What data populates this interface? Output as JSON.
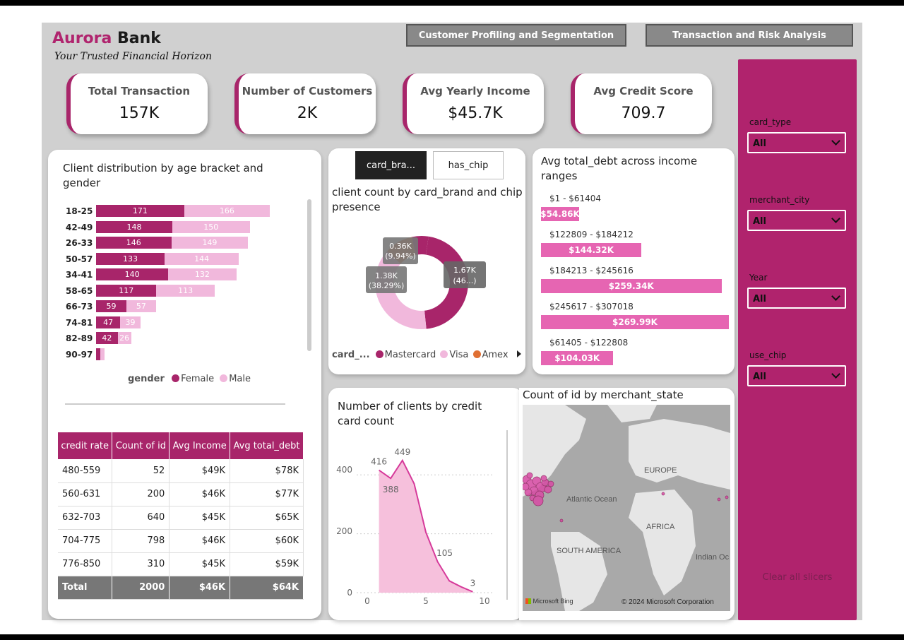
{
  "header": {
    "brand_part1": "Aurora",
    "brand_part2": "Bank",
    "tagline": "Your Trusted Financial Horizon"
  },
  "nav": {
    "btn1": "Customer Profiling and Segmentation",
    "btn2": "Transaction and Risk Analysis"
  },
  "kpis": [
    {
      "title": "Total Transaction",
      "value": "157K"
    },
    {
      "title": "Number of Customers",
      "value": "2K"
    },
    {
      "title": "Avg Yearly Income",
      "value": "$45.7K"
    },
    {
      "title": "Avg Credit Score",
      "value": "709.7"
    }
  ],
  "colors": {
    "primary": "#b0236d",
    "female": "#a8256a",
    "male": "#f1b8dc",
    "mastercard": "#a8256a",
    "visa": "#f1b8dc",
    "amex": "#e07033",
    "income_bar": "#e665b2",
    "area": "#f6c0dc"
  },
  "age_chart": {
    "title": "Client distribution by age bracket and gender",
    "legend_title": "gender",
    "legend_female": "Female",
    "legend_male": "Male",
    "max_total": 337,
    "rows": [
      {
        "bracket": "18-25",
        "female": 171,
        "male": 166
      },
      {
        "bracket": "42-49",
        "female": 148,
        "male": 150
      },
      {
        "bracket": "26-33",
        "female": 146,
        "male": 149
      },
      {
        "bracket": "50-57",
        "female": 133,
        "male": 144
      },
      {
        "bracket": "34-41",
        "female": 140,
        "male": 132
      },
      {
        "bracket": "58-65",
        "female": 117,
        "male": 113
      },
      {
        "bracket": "66-73",
        "female": 59,
        "male": 57
      },
      {
        "bracket": "74-81",
        "female": 47,
        "male": 39
      },
      {
        "bracket": "82-89",
        "female": 42,
        "male": 26
      },
      {
        "bracket": "90-97",
        "female": 8,
        "male": 8
      }
    ]
  },
  "credit_table": {
    "headers": [
      "credit rate",
      "Count of id",
      "Avg Income",
      "Avg total_debt"
    ],
    "rows": [
      [
        "480-559",
        "52",
        "$49K",
        "$78K"
      ],
      [
        "560-631",
        "200",
        "$46K",
        "$77K"
      ],
      [
        "632-703",
        "640",
        "$45K",
        "$65K"
      ],
      [
        "704-775",
        "798",
        "$46K",
        "$60K"
      ],
      [
        "776-850",
        "310",
        "$45K",
        "$59K"
      ]
    ],
    "total": [
      "Total",
      "2000",
      "$46K",
      "$64K"
    ]
  },
  "card_panel": {
    "tab1": "card_bra...",
    "tab2": "has_chip",
    "title": "client count by card_brand and chip presence",
    "legend_title": "card_...",
    "legend": [
      "Mastercard",
      "Visa",
      "Amex"
    ],
    "slice_labels": {
      "mastercard_value": "1.67K",
      "mastercard_pct": "(46...)",
      "visa_value": "1.38K",
      "visa_pct": "(38.29%)",
      "amex_value": "0.36K",
      "amex_pct": "(9.94%)"
    }
  },
  "income_chart": {
    "title": "Avg total_debt across income ranges",
    "max_value": 269.99,
    "rows": [
      {
        "range": "$1 - $61404",
        "label": "$54.86K",
        "value": 54.86
      },
      {
        "range": "$122809 - $184212",
        "label": "$144.32K",
        "value": 144.32
      },
      {
        "range": "$184213 - $245616",
        "label": "$259.34K",
        "value": 259.34
      },
      {
        "range": "$245617 - $307018",
        "label": "$269.99K",
        "value": 269.99
      },
      {
        "range": "$61405 - $122808",
        "label": "$104.03K",
        "value": 104.03
      }
    ]
  },
  "cards_chart": {
    "title": "Number of clients by credit card count",
    "y_ticks": [
      "400",
      "200",
      "0"
    ],
    "x_ticks": [
      "0",
      "5",
      "10"
    ],
    "ylim": [
      0,
      470
    ],
    "xlim": [
      0,
      10
    ],
    "points": [
      [
        1,
        416
      ],
      [
        2,
        388
      ],
      [
        3,
        449
      ],
      [
        4,
        370
      ],
      [
        5,
        205
      ],
      [
        6,
        105
      ],
      [
        7,
        40
      ],
      [
        8,
        20
      ],
      [
        9,
        3
      ]
    ],
    "labels": [
      {
        "x": 1,
        "y": 416,
        "text": "416"
      },
      {
        "x": 2,
        "y": 388,
        "text": "388"
      },
      {
        "x": 3,
        "y": 449,
        "text": "449"
      },
      {
        "x": 6,
        "y": 105,
        "text": "105"
      },
      {
        "x": 9,
        "y": 3,
        "text": "3"
      }
    ]
  },
  "map": {
    "title": "Count of id by merchant_state",
    "labels": {
      "europe": "EUROPE",
      "atlantic": "Atlantic Ocean",
      "africa": "AFRICA",
      "south_america": "SOUTH AMERICA",
      "indian": "Indian Oc"
    },
    "bing": "Microsoft Bing",
    "copyright": "© 2024 Microsoft Corporation"
  },
  "slicers": {
    "card_type_label": "card_type",
    "card_type_value": "All",
    "merchant_city_label": "merchant_city",
    "merchant_city_value": "All",
    "year_label": "Year",
    "year_value": "All",
    "use_chip_label": "use_chip",
    "use_chip_value": "All",
    "clear_label": "Clear all slicers"
  }
}
